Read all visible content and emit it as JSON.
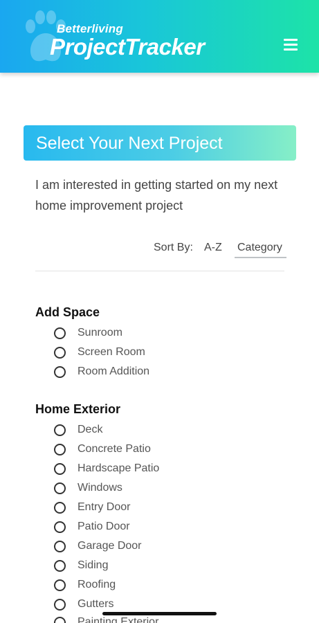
{
  "header": {
    "brand_small": "Betterliving",
    "brand_large": "ProjectTracker",
    "menu_icon": "hamburger-menu-icon",
    "logo_icon": "paw-print-icon"
  },
  "banner": {
    "title": "Select Your Next Project"
  },
  "intro": "I am interested in getting started on my next home improvement project",
  "sort": {
    "label": "Sort By:",
    "az": "A-Z",
    "category": "Category",
    "selected": "Category"
  },
  "categories": [
    {
      "title": "Add Space",
      "items": [
        "Sunroom",
        "Screen Room",
        "Room Addition"
      ]
    },
    {
      "title": "Home Exterior",
      "items": [
        "Deck",
        "Concrete Patio",
        "Hardscape Patio",
        "Windows",
        "Entry Door",
        "Patio Door",
        "Garage Door",
        "Siding",
        "Roofing",
        "Gutters",
        "Painting Exterior"
      ]
    }
  ],
  "colors": {
    "header_gradient_start": "#1aa7f0",
    "header_gradient_end": "#1de3a8",
    "banner_gradient_end": "#86efc7"
  }
}
